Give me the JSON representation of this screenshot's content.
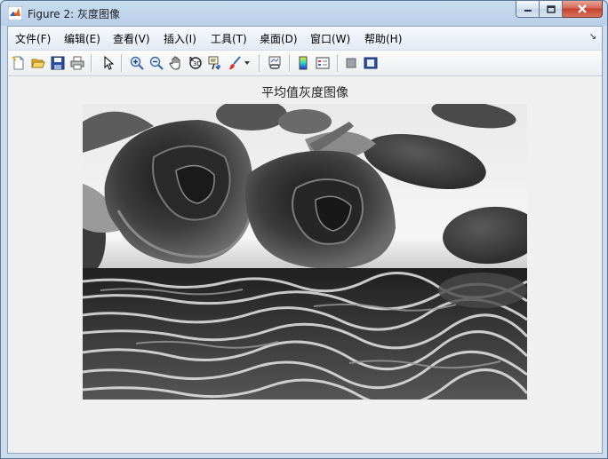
{
  "window": {
    "title": "Figure 2: 灰度图像"
  },
  "menu": {
    "items": [
      {
        "label": "文件(F)",
        "name": "menu-file"
      },
      {
        "label": "编辑(E)",
        "name": "menu-edit"
      },
      {
        "label": "查看(V)",
        "name": "menu-view"
      },
      {
        "label": "插入(I)",
        "name": "menu-insert"
      },
      {
        "label": "工具(T)",
        "name": "menu-tools"
      },
      {
        "label": "桌面(D)",
        "name": "menu-desktop"
      },
      {
        "label": "窗口(W)",
        "name": "menu-window"
      },
      {
        "label": "帮助(H)",
        "name": "menu-help"
      }
    ]
  },
  "toolbar": {
    "icons": [
      "new-figure-icon",
      "open-file-icon",
      "save-icon",
      "print-icon",
      "pointer-icon",
      "zoom-in-icon",
      "zoom-out-icon",
      "pan-icon",
      "rotate-3d-icon",
      "data-cursor-icon",
      "brush-icon",
      "brush-dropdown-icon",
      "link-plot-icon",
      "colorbar-icon",
      "legend-icon",
      "hide-plot-tools-icon",
      "show-plot-tools-icon"
    ]
  },
  "figure": {
    "title": "平均值灰度图像",
    "image_description_colors": {
      "dark": "#2b2b2b",
      "mid": "#6a6a6a",
      "light": "#f2f2f2"
    }
  }
}
